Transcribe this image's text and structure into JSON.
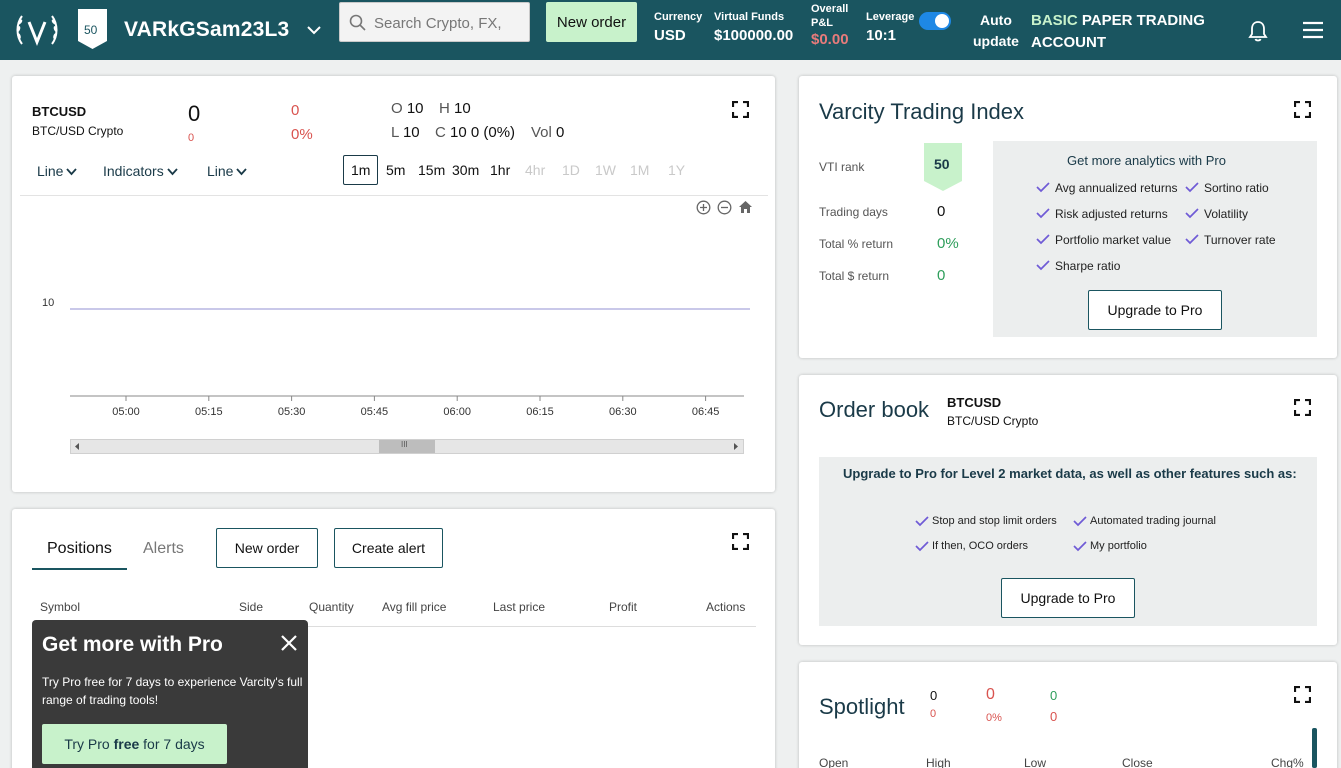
{
  "header": {
    "rank": "50",
    "username": "VARkGSam23L3",
    "search_placeholder": "Search Crypto, FX,",
    "new_order_label": "New order",
    "currency_label": "Currency",
    "currency_value": "USD",
    "funds_label": "Virtual Funds",
    "funds_value": "$100000.00",
    "pnl_label_1": "Overall",
    "pnl_label_2": "P&L",
    "pnl_value": "$0.00",
    "leverage_label": "Leverage",
    "leverage_value": "10:1",
    "auto_update_1": "Auto",
    "auto_update_2": "update",
    "account_basic": "BASIC",
    "account_rest_1": "PAPER TRADING",
    "account_rest_2": "ACCOUNT",
    "colors": {
      "bg": "#1a5560",
      "accent": "#c8f2cb",
      "toggle": "#1e88e5"
    }
  },
  "chart_panel": {
    "symbol": "BTCUSD",
    "symbol_desc": "BTC/USD Crypto",
    "price": "0",
    "price_change": "0",
    "change_abs": "0",
    "change_pct": "0%",
    "o_label": "O",
    "o_value": "10",
    "h_label": "H",
    "h_value": "10",
    "l_label": "L",
    "l_value": "10",
    "c_label": "C",
    "c_value": "10 0 (0%)",
    "vol_label": "Vol",
    "vol_value": "0",
    "dropdowns": [
      "Line",
      "Indicators",
      "Line"
    ],
    "timeframes": [
      "1m",
      "5m",
      "15m",
      "30m",
      "1hr",
      "4hr",
      "1D",
      "1W",
      "1M",
      "1Y"
    ],
    "scroll_label": "III"
  },
  "chart_data": {
    "type": "line",
    "x": [
      "05:00",
      "05:15",
      "05:30",
      "05:45",
      "06:00",
      "06:15",
      "06:30",
      "06:45"
    ],
    "y_ticks": [
      "10"
    ],
    "series": [
      {
        "values": [
          10,
          10,
          10,
          10,
          10,
          10,
          10,
          10
        ]
      }
    ],
    "ylim": [
      9,
      11
    ],
    "line_color": "#a9a8dc"
  },
  "positions": {
    "tab_positions": "Positions",
    "tab_alerts": "Alerts",
    "new_order_label": "New order",
    "create_alert_label": "Create alert",
    "columns": [
      "Symbol",
      "Side",
      "Quantity",
      "Avg fill price",
      "Last price",
      "Profit",
      "Actions"
    ]
  },
  "promo": {
    "title": "Get more with Pro",
    "text": "Try Pro free for 7 days to experience Varcity's full range of trading tools!",
    "btn_pre": "Try Pro",
    "btn_bold": "free",
    "btn_post": "for 7 days"
  },
  "vti": {
    "title": "Varcity Trading Index",
    "rank_label": "VTI rank",
    "rank_value": "50",
    "days_label": "Trading days",
    "days_value": "0",
    "pct_label": "Total % return",
    "pct_value": "0%",
    "dollar_label": "Total $ return",
    "dollar_value": "0",
    "pro_title": "Get more analytics with Pro",
    "features": [
      "Avg annualized returns",
      "Sortino ratio",
      "Risk adjusted returns",
      "Volatility",
      "Portfolio market value",
      "Turnover rate",
      "Sharpe ratio"
    ],
    "upgrade_label": "Upgrade to Pro"
  },
  "order_book": {
    "title": "Order book",
    "symbol": "BTCUSD",
    "symbol_desc": "BTC/USD Crypto",
    "pro_text": "Upgrade to Pro for Level 2 market data, as well as other features such as:",
    "features": [
      "Stop and stop limit orders",
      "Automated trading journal",
      "If then, OCO orders",
      "My portfolio"
    ],
    "upgrade_label": "Upgrade to Pro"
  },
  "spotlight": {
    "title": "Spotlight",
    "price": "0",
    "price_sub": "0",
    "change": "0",
    "change_pct": "0%",
    "val_a": "0",
    "val_b": "0",
    "columns": [
      "Open",
      "High",
      "Low",
      "Close",
      "Chg%"
    ]
  }
}
